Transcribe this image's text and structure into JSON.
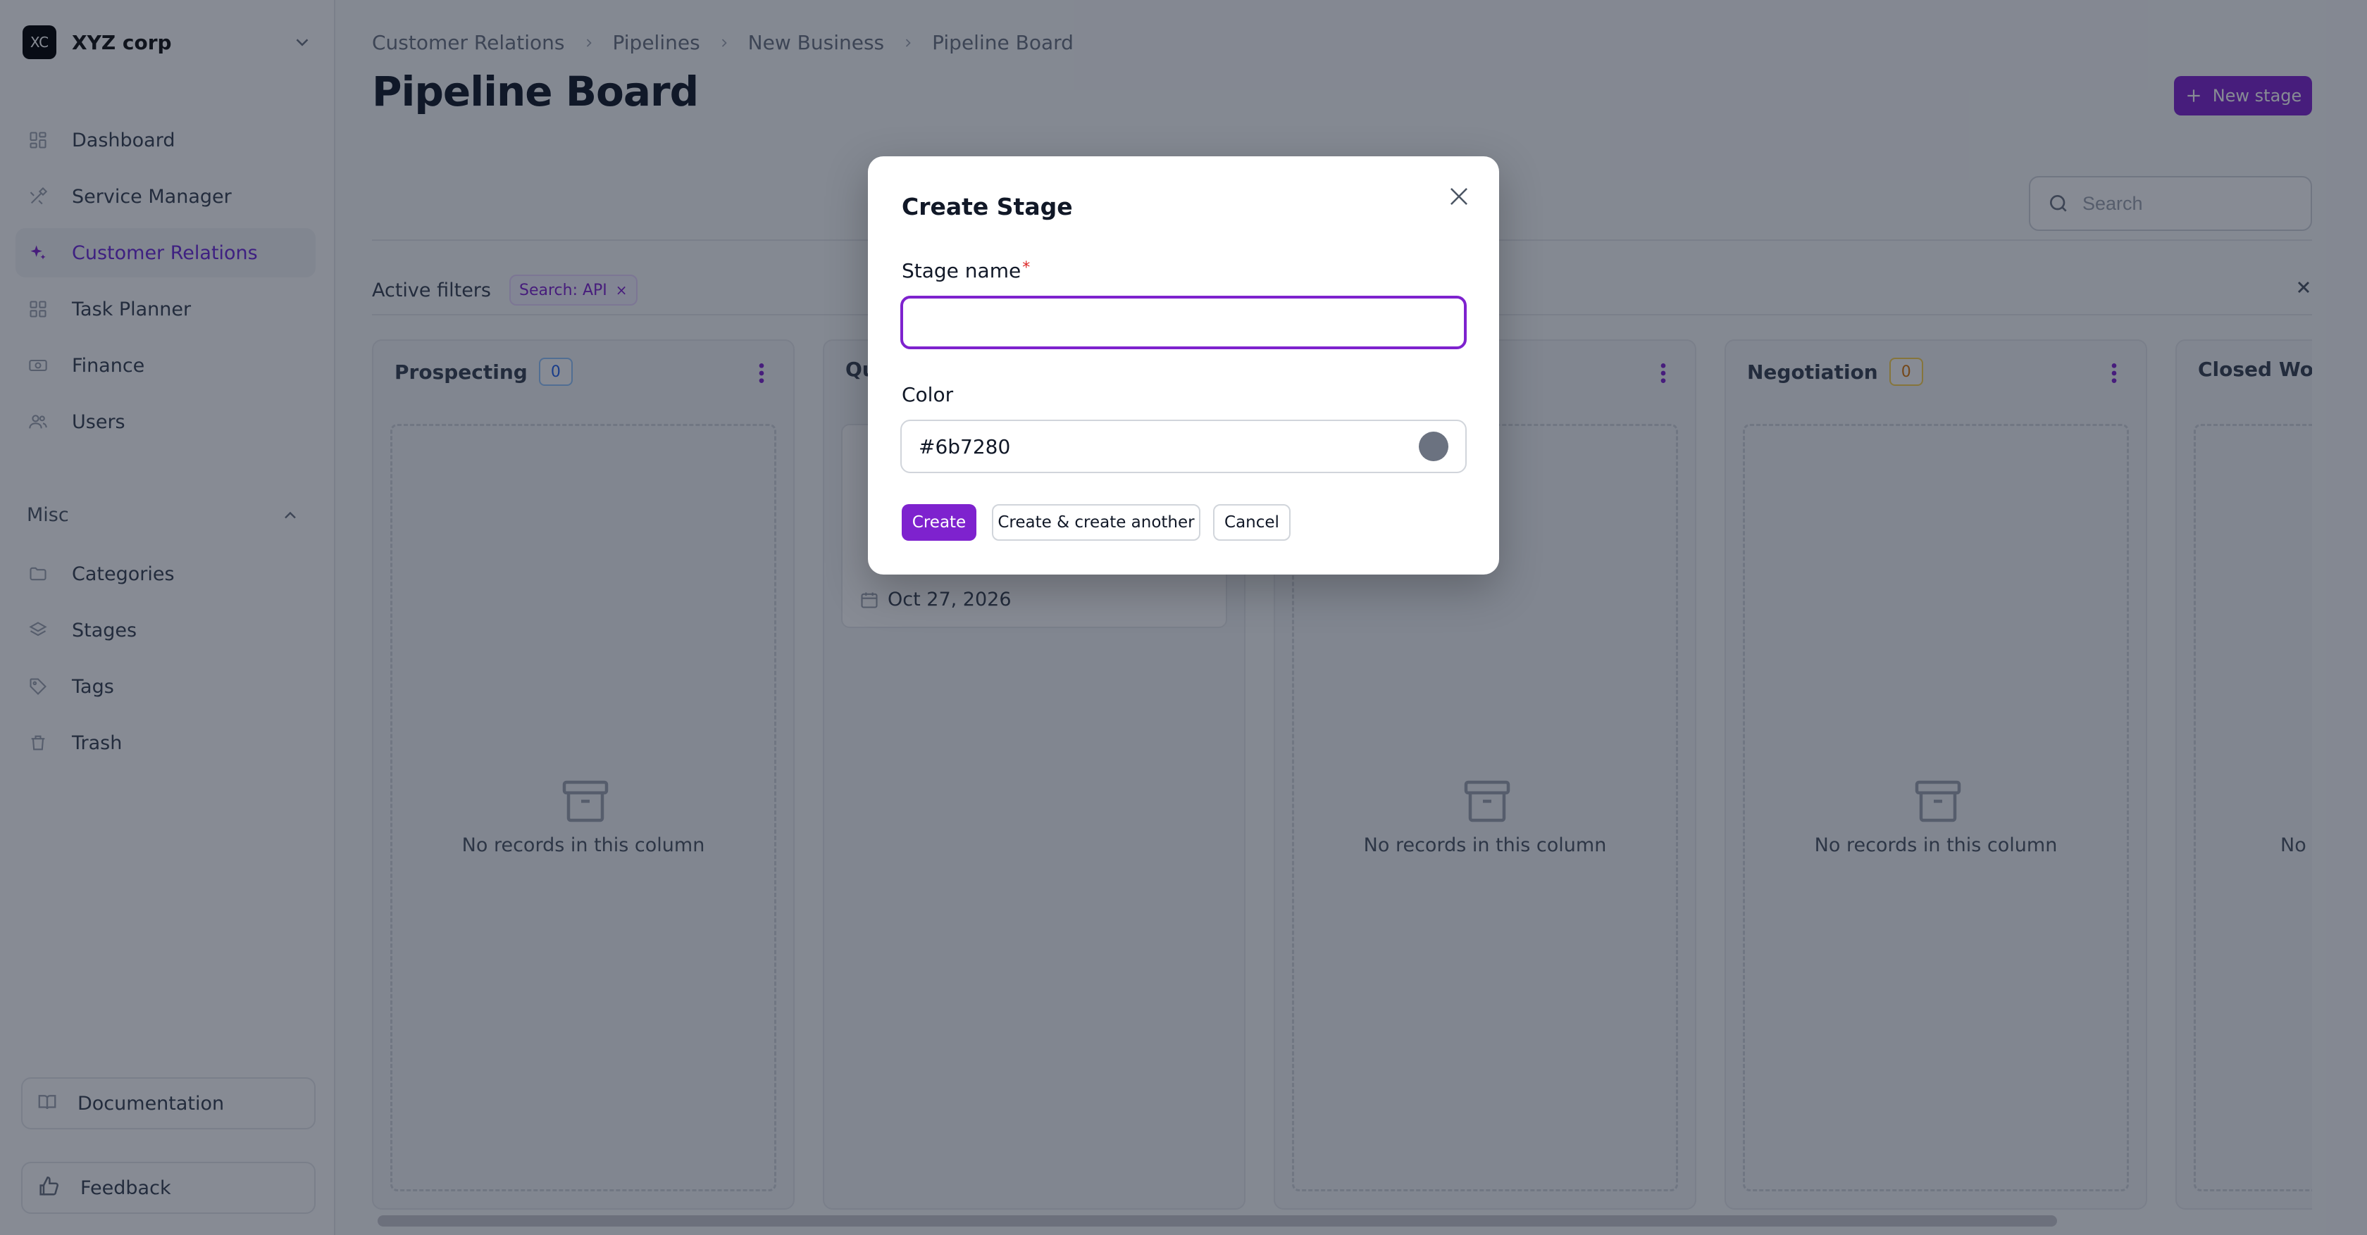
{
  "org": {
    "logo": "XC",
    "name": "XYZ corp"
  },
  "sidebar": {
    "items": [
      {
        "label": "Dashboard",
        "icon": "dashboard-icon"
      },
      {
        "label": "Service Manager",
        "icon": "tools-icon"
      },
      {
        "label": "Customer Relations",
        "icon": "sparkles-icon",
        "active": true
      },
      {
        "label": "Task Planner",
        "icon": "grid-icon"
      },
      {
        "label": "Finance",
        "icon": "banknote-icon"
      },
      {
        "label": "Users",
        "icon": "users-icon"
      }
    ],
    "group_label": "Misc",
    "misc_items": [
      {
        "label": "Categories",
        "icon": "folder-icon"
      },
      {
        "label": "Stages",
        "icon": "layers-icon"
      },
      {
        "label": "Tags",
        "icon": "tag-icon"
      },
      {
        "label": "Trash",
        "icon": "trash-icon"
      }
    ],
    "documentation": "Documentation",
    "feedback": "Feedback"
  },
  "breadcrumb": [
    "Customer Relations",
    "Pipelines",
    "New Business",
    "Pipeline Board"
  ],
  "page_title": "Pipeline Board",
  "new_stage_label": "New stage",
  "search": {
    "placeholder": "Search"
  },
  "filters": {
    "label": "Active filters",
    "chip": "Search: API"
  },
  "columns": [
    {
      "title": "Prospecting",
      "count": "0",
      "empty_text": "No records in this column"
    },
    {
      "title": "Qu",
      "card_date": "Oct 27, 2026"
    },
    {
      "title": "",
      "empty_text": "No records in this column"
    },
    {
      "title": "Negotiation",
      "count": "0",
      "empty_text": "No records in this column"
    },
    {
      "title": "Closed Won",
      "empty_text": "No r"
    }
  ],
  "modal": {
    "title": "Create Stage",
    "stage_name_label": "Stage name",
    "required_mark": "*",
    "stage_name_value": "",
    "color_label": "Color",
    "color_value": "#6b7280",
    "create": "Create",
    "create_another": "Create & create another",
    "cancel": "Cancel"
  },
  "colors": {
    "accent": "#7e22ce",
    "swatch": "#6b7280"
  }
}
